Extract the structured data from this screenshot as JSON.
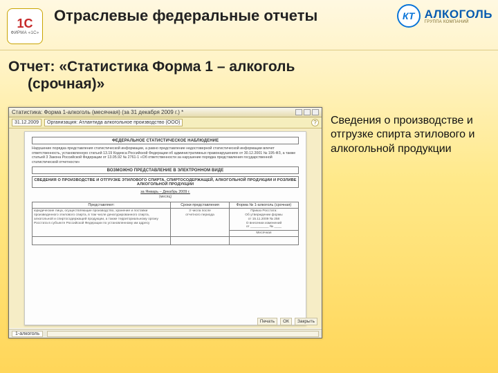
{
  "header": {
    "logo1c_top": "1С",
    "logo1c_bottom": "ФИРМА «1С»",
    "kt_text": "КТ",
    "alc_main": "АЛКОГОЛЬ",
    "alc_sub": "ГРУППА КОМПАНИЙ",
    "slide_title": "Отраслевые федеральные отчеты"
  },
  "subtitle": {
    "line1": "Отчет: «Статистика Форма 1 – алкоголь",
    "line2": "(срочная)»"
  },
  "body_text": "Сведения о производстве и отгрузке спирта этилового и алкогольной продукции",
  "app": {
    "title": "Статистика: Форма 1-алкоголь (месячная) (за 31 декабря 2009 г.) *",
    "date_chip": "31.12.2009",
    "org_label": "Организация:",
    "org_value": "Атлантида алкогольное производство (ООО)",
    "help": "?",
    "scroll_tab": "1-алкоголь",
    "status_print": "Печать",
    "status_ok": "ОК",
    "status_close": "Закрыть"
  },
  "doc": {
    "top_box": "ФЕДЕРАЛЬНОЕ СТАТИСТИЧЕСКОЕ НАБЛЮДЕНИЕ",
    "para1": "Нарушение порядка представления статистической информации, а равно представление недостоверной статистической информации влечет ответственность, установленную статьей 13.19 Кодекса Российской Федерации об административных правонарушениях от 30.12.2001 № 195-ФЗ, а также статьей 3 Закона Российской Федерации от 13.05.92 № 2761-1 «Об ответственности за нарушение порядка представления государственной статистической отчетности»",
    "mid_box": "ВОЗМОЖНО ПРЕДСТАВЛЕНИЕ В ЭЛЕКТРОННОМ ВИДЕ",
    "title_box": "СВЕДЕНИЯ О ПРОИЗВОДСТВЕ И ОТГРУЗКЕ ЭТИЛОВОГО СПИРТА, СПИРТОСОДЕРЖАЩЕЙ, АЛКОГОЛЬНОЙ ПРОДУКЦИИ И РОЗЛИВЕ АЛКОГОЛЬНОЙ ПРОДУКЦИИ",
    "period_line": "за Январь – Декабрь 2009 г.",
    "period_sub": "(месяц)",
    "t_col1": "Представляют:",
    "t_col2": "Сроки представления",
    "t_col3": "Форма № 1-алкоголь (срочная)",
    "t_row1": "юридические лица, осуществляющие производство, хранение и поставки произведенного этилового спирта, в том числе денатурированного спирта, алкогольной и спиртосодержащей продукции, а также территориальному органу Росстата в субъекте Российской Федерации по установленному им адресу",
    "t_row2_a": "3 числа после",
    "t_row2_b": "отчетного периода",
    "t_note1": "Приказ Росстата:",
    "t_note2": "Об утверждении формы",
    "t_note3": "от 15.11.2009 № 258",
    "t_note4": "О внесении изменений",
    "t_note5": "от __________ № ____",
    "t_cadence": "Месячная"
  }
}
